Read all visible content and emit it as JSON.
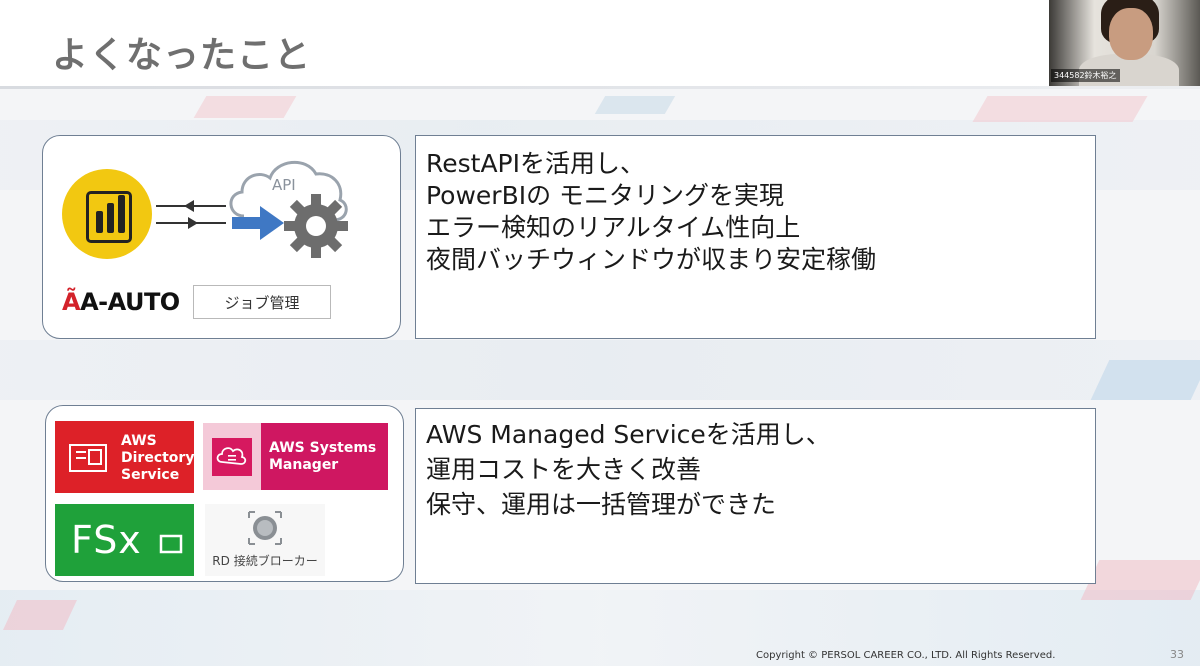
{
  "slide": {
    "title": "よくなったこと",
    "page_number": "33",
    "copyright": "Copyright © PERSOL CAREER CO., LTD. All Rights Reserved."
  },
  "webcam": {
    "participant_name": "344582鈴木裕之"
  },
  "section1": {
    "lines": [
      "RestAPIを活用し、",
      " PowerBIの モニタリングを実現",
      " エラー検知のリアルタイム性向上",
      " 夜間バッチウィンドウが収まり安定稼働"
    ],
    "diagram": {
      "api_label": "API",
      "aauto_logo": "A-AUTO",
      "job_tag": "ジョブ管理",
      "icons": [
        "powerbi-icon",
        "api-cloud-icon",
        "gear-icon",
        "right-arrow-icon"
      ]
    }
  },
  "section2": {
    "lines": [
      "AWS Managed Serviceを活用し、",
      "運用コストを大きく改善",
      "保守、運用は一括管理ができた"
    ],
    "tiles": {
      "directory_service": [
        "AWS",
        "Directory",
        "Service"
      ],
      "systems_manager": [
        "AWS Systems",
        "Manager"
      ],
      "fsx": "FSx",
      "rd_broker": "RD 接続ブローカー"
    }
  },
  "colors": {
    "aws_red": "#dd2128",
    "aws_pink": "#cf1761",
    "fsx_green": "#1fa13a",
    "pbi_yellow": "#f2c811",
    "border": "#6f7f93",
    "arrow_blue": "#3f78c4"
  }
}
